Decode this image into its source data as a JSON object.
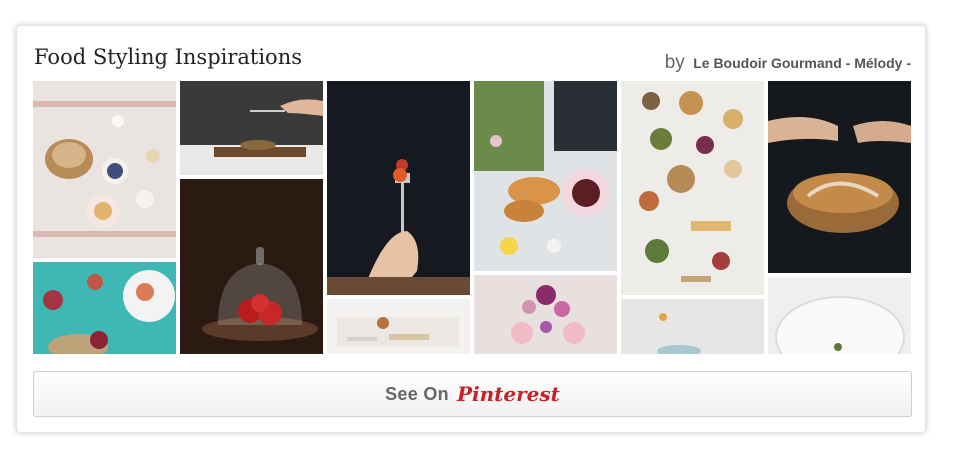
{
  "board": {
    "title": "Food Styling Inspirations",
    "by_label": "by",
    "author": "Le Boudoir Gourmand - Mélody -"
  },
  "pins": [
    {
      "name": "pin-bread-breakfast-table",
      "icon": "food-photo"
    },
    {
      "name": "pin-pomegranate-teal",
      "icon": "food-photo"
    },
    {
      "name": "pin-hand-cutting-board",
      "icon": "food-photo"
    },
    {
      "name": "pin-cake-dome-dark",
      "icon": "food-photo"
    },
    {
      "name": "pin-fork-dark-background",
      "icon": "food-photo"
    },
    {
      "name": "pin-letter-biscuits",
      "icon": "food-photo"
    },
    {
      "name": "pin-croissants-flowers",
      "icon": "food-photo"
    },
    {
      "name": "pin-pink-plates-flowers",
      "icon": "food-photo"
    },
    {
      "name": "pin-tapas-overhead",
      "icon": "food-photo"
    },
    {
      "name": "pin-cups-light",
      "icon": "food-photo"
    },
    {
      "name": "pin-pie-hands",
      "icon": "food-photo"
    },
    {
      "name": "pin-white-bowl",
      "icon": "food-photo"
    }
  ],
  "button": {
    "label": "See On",
    "brand": "Pinterest"
  },
  "colors": {
    "brand_red": "#cb2027",
    "button_text": "#666666",
    "border": "#e2e2e2"
  }
}
